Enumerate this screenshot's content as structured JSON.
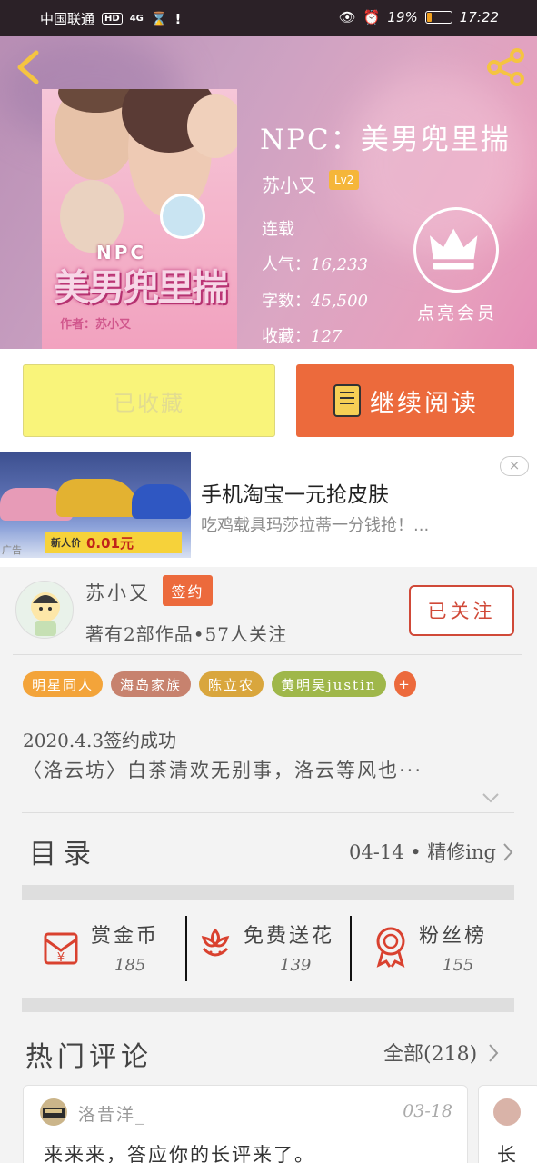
{
  "status_bar": {
    "carrier": "中国联通",
    "hd": "HD",
    "network": "4G",
    "battery_percent": "19%",
    "battery_level": 0.19,
    "time": "17:22"
  },
  "book": {
    "title": "NPC：美男兜里揣",
    "author": "苏小又",
    "author_level": "Lv2",
    "status": "连载",
    "popularity_label": "人气：",
    "popularity": "16,233",
    "words_label": "字数：",
    "words": "45,500",
    "favorites_label": "收藏：",
    "favorites": "127",
    "vip_label": "点亮会员",
    "cover": {
      "npc_text": "NPC",
      "title_art": "美男兜里揣",
      "author_line": "作者：苏小又"
    }
  },
  "actions": {
    "collected_label": "已收藏",
    "continue_label": "继续阅读"
  },
  "ad": {
    "title": "手机淘宝一元抢皮肤",
    "subtitle": "吃鸡载具玛莎拉蒂一分钱抢！...",
    "close": "×",
    "label": "广告",
    "price_prefix": "新人价",
    "price": "0.01元"
  },
  "author_card": {
    "name": "苏小又",
    "signed_badge": "签约",
    "stats": "著有2部作品•57人关注",
    "follow_label": "已关注",
    "tags": [
      {
        "label": "明星同人",
        "color": "#f3a43a"
      },
      {
        "label": "海岛家族",
        "color": "#c7826e"
      },
      {
        "label": "陈立农",
        "color": "#d9a63d"
      },
      {
        "label": "黄明昊justin",
        "color": "#9fb74a"
      },
      {
        "label": "+",
        "color": "#ec6a3c"
      }
    ],
    "sign_date": "2020.4.3签约成功",
    "quote": "〈洛云坊〉白茶清欢无别事，洛云等风也···"
  },
  "catalog": {
    "title": "目录",
    "status": "04-14 • 精修ing"
  },
  "rewards": [
    {
      "label": "赏金币",
      "count": "185",
      "icon": "red-envelope-icon"
    },
    {
      "label": "免费送花",
      "count": "139",
      "icon": "flower-icon"
    },
    {
      "label": "粉丝榜",
      "count": "155",
      "icon": "medal-icon"
    }
  ],
  "hot_comments": {
    "title": "热门评论",
    "all_label": "全部(218)",
    "items": [
      {
        "user": "洛昔洋_",
        "date": "03-18",
        "text": "来来来，答应你的长评来了。"
      },
      {
        "text": "长"
      }
    ]
  },
  "colors": {
    "accent_orange": "#ec6a3c",
    "collected_yellow": "#f9f47a",
    "follow_red": "#d04938",
    "level_gold": "#f5b63a"
  }
}
